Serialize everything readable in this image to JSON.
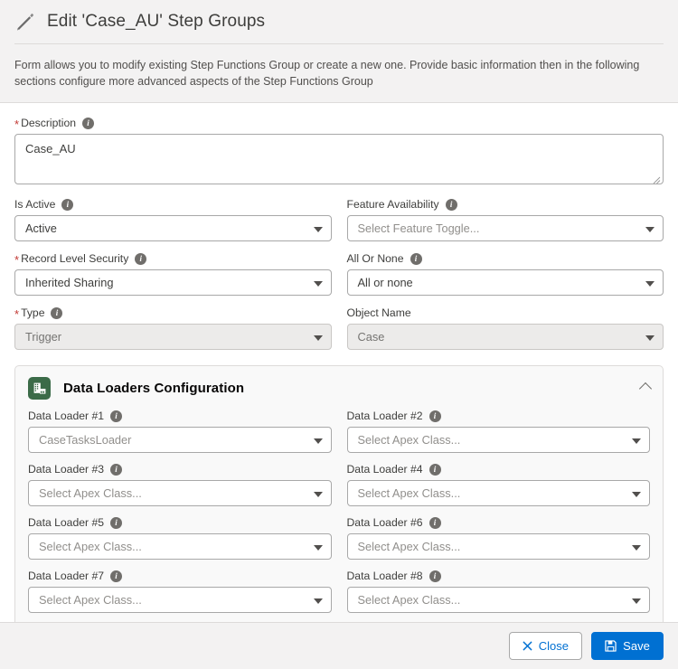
{
  "header": {
    "icon": "pencil-icon",
    "title": "Edit 'Case_AU' Step Groups",
    "description": "Form allows you to modify existing Step Functions Group or create a new one. Provide basic information then in the following sections configure more advanced aspects of the Step Functions Group"
  },
  "form": {
    "description": {
      "label": "Description",
      "required": true,
      "info": "i",
      "value": "Case_AU"
    },
    "is_active": {
      "label": "Is Active",
      "info": "i",
      "value": "Active",
      "disabled": false
    },
    "feature_availability": {
      "label": "Feature Availability",
      "info": "i",
      "value": "Select Feature Toggle...",
      "is_placeholder": true
    },
    "record_level_security": {
      "label": "Record Level Security",
      "required": true,
      "info": "i",
      "value": "Inherited Sharing"
    },
    "all_or_none": {
      "label": "All Or None",
      "info": "i",
      "value": "All or none"
    },
    "type": {
      "label": "Type",
      "required": true,
      "info": "i",
      "value": "Trigger",
      "disabled": true
    },
    "object_name": {
      "label": "Object Name",
      "value": "Case",
      "disabled": true
    }
  },
  "section": {
    "icon": "data-table-icon",
    "title": "Data Loaders Configuration",
    "collapse_icon": "chevron-up-icon",
    "accent_color": "#3b6b48",
    "loaders": [
      {
        "label": "Data Loader #1",
        "info": "i",
        "value": "CaseTasksLoader",
        "is_placeholder": false
      },
      {
        "label": "Data Loader #2",
        "info": "i",
        "value": "Select Apex Class...",
        "is_placeholder": true
      },
      {
        "label": "Data Loader #3",
        "info": "i",
        "value": "Select Apex Class...",
        "is_placeholder": true
      },
      {
        "label": "Data Loader #4",
        "info": "i",
        "value": "Select Apex Class...",
        "is_placeholder": true
      },
      {
        "label": "Data Loader #5",
        "info": "i",
        "value": "Select Apex Class...",
        "is_placeholder": true
      },
      {
        "label": "Data Loader #6",
        "info": "i",
        "value": "Select Apex Class...",
        "is_placeholder": true
      },
      {
        "label": "Data Loader #7",
        "info": "i",
        "value": "Select Apex Class...",
        "is_placeholder": true
      },
      {
        "label": "Data Loader #8",
        "info": "i",
        "value": "Select Apex Class...",
        "is_placeholder": true
      }
    ]
  },
  "footer": {
    "close_label": "Close",
    "close_icon": "close-x-icon",
    "save_label": "Save",
    "save_icon": "floppy-disk-icon",
    "primary_color": "#0070d2"
  }
}
